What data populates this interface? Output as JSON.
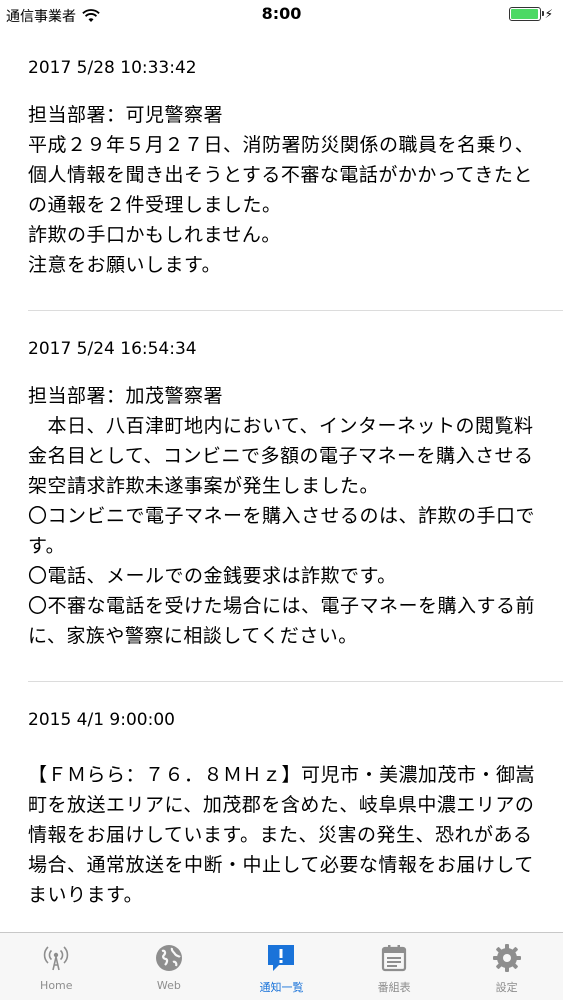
{
  "status_bar": {
    "carrier": "通信事業者",
    "time": "8:00"
  },
  "entries": [
    {
      "date": "2017 5/28 10:33:42",
      "body": "担当部署：可児警察署\n平成２９年５月２７日、消防署防災関係の職員を名乗り、個人情報を聞き出そうとする不審な電話がかかってきたとの通報を２件受理しました。\n詐欺の手口かもしれません。\n注意をお願いします。"
    },
    {
      "date": "2017 5/24 16:54:34",
      "body": "担当部署：加茂警察署\n　本日、八百津町地内において、インターネットの閲覧料金名目として、コンビニで多額の電子マネーを購入させる架空請求詐欺未遂事案が発生しました。\n〇コンビニで電子マネーを購入させるのは、詐欺の手口です。\n〇電話、メールでの金銭要求は詐欺です。\n〇不審な電話を受けた場合には、電子マネーを購入する前に、家族や警察に相談してください。"
    },
    {
      "date": "2015 4/1 9:00:00",
      "body": "【ＦＭらら：７６．８ＭＨｚ】可児市・美濃加茂市・御嵩町を放送エリアに、加茂郡を含めた、岐阜県中濃エリアの情報をお届けしています。また、災害の発生、恐れがある場合、通常放送を中断・中止して必要な情報をお届けしてまいります。"
    }
  ],
  "tab_bar": {
    "tabs": [
      {
        "label": "Home",
        "icon": "radio-tower-icon",
        "active": false
      },
      {
        "label": "Web",
        "icon": "globe-icon",
        "active": false
      },
      {
        "label": "通知一覧",
        "icon": "notification-icon",
        "active": true
      },
      {
        "label": "番組表",
        "icon": "calendar-icon",
        "active": false
      },
      {
        "label": "設定",
        "icon": "gear-icon",
        "active": false
      }
    ],
    "active_color": "#1a73d9",
    "inactive_color": "#8e8e8e"
  }
}
